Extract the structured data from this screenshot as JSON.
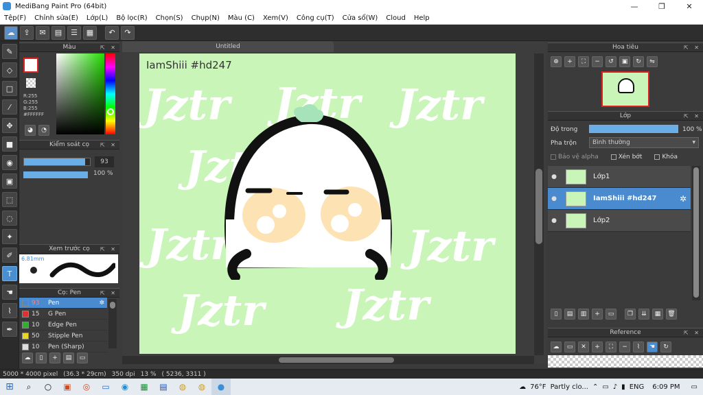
{
  "window": {
    "title": "MediBang Paint Pro (64bit)",
    "minimize": "—",
    "restore": "❐",
    "close": "✕"
  },
  "menu": [
    "Tệp(F)",
    "Chỉnh sửa(E)",
    "Lớp(L)",
    "Bộ lọc(R)",
    "Chọn(S)",
    "Chụp(N)",
    "Màu (C)",
    "Xem(V)",
    "Công cụ(T)",
    "Cửa sổ(W)",
    "Cloud",
    "Help"
  ],
  "color_panel": {
    "title": "Màu",
    "r": "R:255",
    "g": "G:255",
    "b": "B:255",
    "hex": "#FFFFFF"
  },
  "brush_control": {
    "title": "Kiểm soát cọ",
    "size": "93",
    "opacity": "100 %",
    "size_fraction": 0.93,
    "opacity_fraction": 1.0
  },
  "brush_preview": {
    "title": "Xem trước cọ",
    "size_text": "6.81mm"
  },
  "brush_list": {
    "title": "Cọ: Pen",
    "items": [
      {
        "size": "93",
        "name": "Pen",
        "color": "#4a8bd0",
        "active": true
      },
      {
        "size": "15",
        "name": "G Pen",
        "color": "#e03030",
        "active": false
      },
      {
        "size": "10",
        "name": "Edge Pen",
        "color": "#30b030",
        "active": false
      },
      {
        "size": "50",
        "name": "Stipple Pen",
        "color": "#e8d820",
        "active": false
      },
      {
        "size": "10",
        "name": "Pen (Sharp)",
        "color": "#dddddd",
        "active": false
      }
    ]
  },
  "document": {
    "tab": "Untitled",
    "canvas_text": "IamShiii #hd247",
    "watermark": "Jztr",
    "background": "#c9f5b8"
  },
  "navigator": {
    "title": "Hoa tiêu"
  },
  "layers": {
    "title": "Lớp",
    "opacity_label": "Độ trong",
    "opacity_value": "100 %",
    "blend_label": "Pha trộn",
    "blend_value": "Bình thường",
    "protect_alpha": "Bảo vệ alpha",
    "clipping": "Xén bớt",
    "lock": "Khóa",
    "items": [
      {
        "name": "Lớp1",
        "active": false
      },
      {
        "name": "IamShiii #hd247",
        "active": true
      },
      {
        "name": "Lớp2",
        "active": false
      }
    ]
  },
  "reference": {
    "title": "Reference"
  },
  "status": {
    "size": "5000 * 4000 pixel",
    "cm": "(36.3 * 29cm)",
    "dpi": "350 dpi",
    "zoom": "13 %",
    "coords": "( 5236, 3311 )"
  },
  "taskbar": {
    "weather_temp": "76°F",
    "weather_text": "Partly clo...",
    "lang": "ENG",
    "time": "6:09 PM"
  }
}
